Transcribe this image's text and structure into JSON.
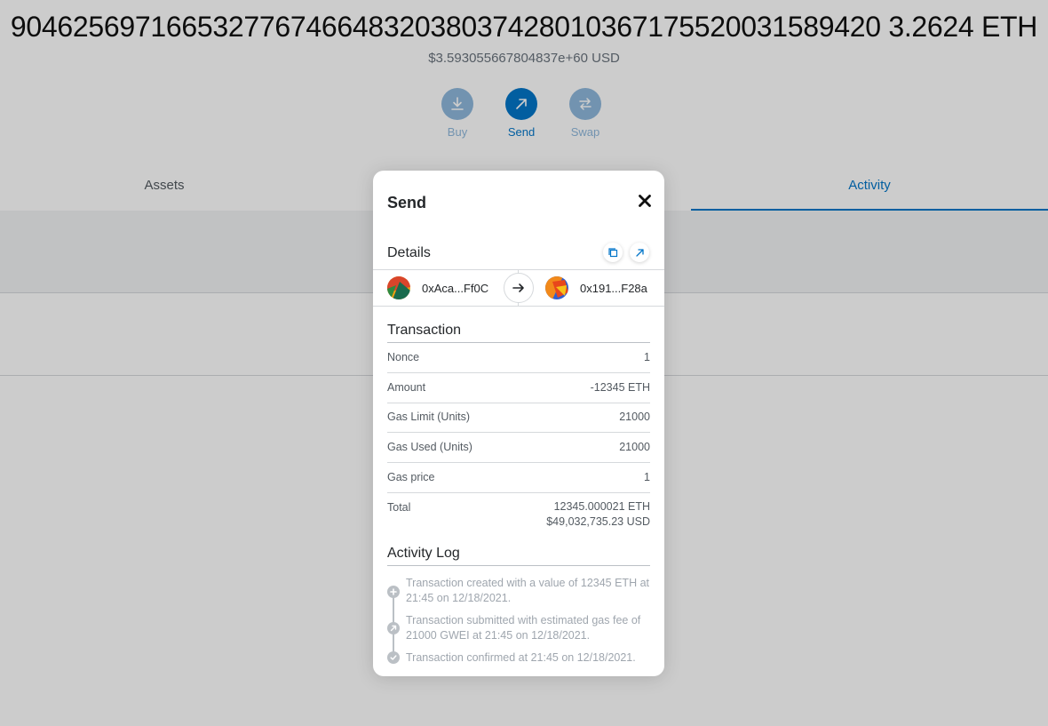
{
  "wallet": {
    "balance": "90462569716653277674664832038037428010367175520031589420 3.2624 ETH",
    "fiat": "$3.593055667804837e+60 USD"
  },
  "actions": {
    "buy": "Buy",
    "send": "Send",
    "swap": "Swap"
  },
  "tabs": {
    "assets": "Assets",
    "activity": "Activity"
  },
  "modal": {
    "title": "Send",
    "details_title": "Details",
    "from": "0xAca...Ff0C",
    "to": "0x191...F28a",
    "transaction_title": "Transaction",
    "rows": [
      {
        "label": "Nonce",
        "value": "1"
      },
      {
        "label": "Amount",
        "value": "-12345 ETH"
      },
      {
        "label": "Gas Limit (Units)",
        "value": "21000"
      },
      {
        "label": "Gas Used (Units)",
        "value": "21000"
      },
      {
        "label": "Gas price",
        "value": "1"
      }
    ],
    "total_label": "Total",
    "total_eth": "12345.000021 ETH",
    "total_usd": "$49,032,735.23 USD",
    "activity_log_title": "Activity Log",
    "log": [
      {
        "icon": "plus-icon",
        "text": "Transaction created with a value of 12345 ETH at 21:45 on 12/18/2021."
      },
      {
        "icon": "arrow-up-right-icon",
        "text": "Transaction submitted with estimated gas fee of 21000 GWEI at 21:45 on 12/18/2021."
      },
      {
        "icon": "check-icon",
        "text": "Transaction confirmed at 21:45 on 12/18/2021."
      }
    ]
  },
  "colors": {
    "accent": "#0376c9",
    "accent_light": "#8fb8dc",
    "overlay": "rgba(0,0,0,0.2)"
  }
}
